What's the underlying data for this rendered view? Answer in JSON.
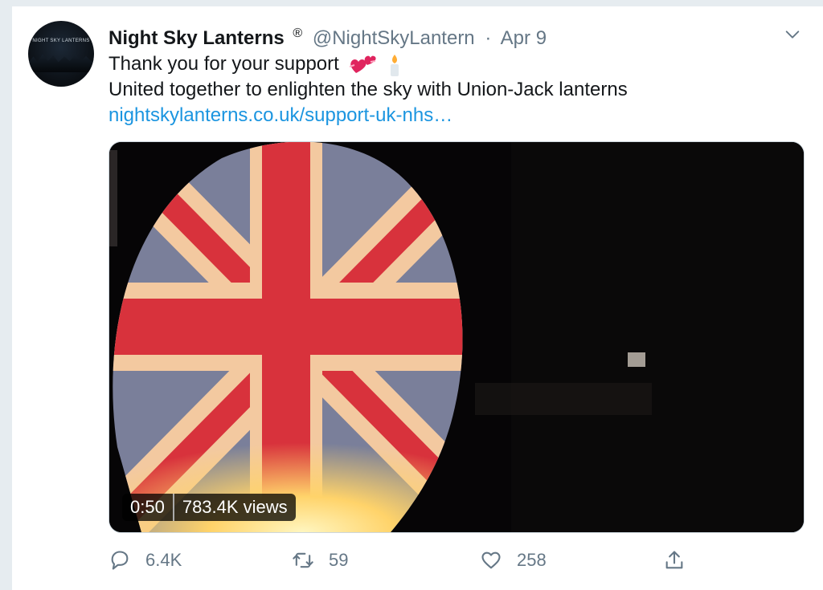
{
  "tweet": {
    "author_name": "Night Sky Lanterns",
    "registered_mark": "®",
    "handle": "@NightSkyLantern",
    "separator": "·",
    "date": "Apr 9",
    "avatar_text": "NIGHT SKY LANTERNS",
    "line1": "Thank you for your support",
    "line2": "United together to enlighten the sky with Union-Jack lanterns",
    "link": "nightskylanterns.co.uk/support-uk-nhs…"
  },
  "video": {
    "duration": "0:50",
    "views": "783.4K views"
  },
  "actions": {
    "replies": "6.4K",
    "retweets": "59",
    "likes": "258"
  },
  "icons": {
    "reply": "reply-icon",
    "retweet": "retweet-icon",
    "like": "heart-icon",
    "share": "share-icon",
    "menu": "chevron-down-icon",
    "emoji1": "two-hearts-icon",
    "emoji2": "candle-icon"
  },
  "colors": {
    "link": "#1b95e0",
    "muted": "#657786",
    "text": "#14171a",
    "flag_red": "#d8323c",
    "flag_white": "#f3c9a0",
    "flag_blue": "#7a7f9a"
  }
}
